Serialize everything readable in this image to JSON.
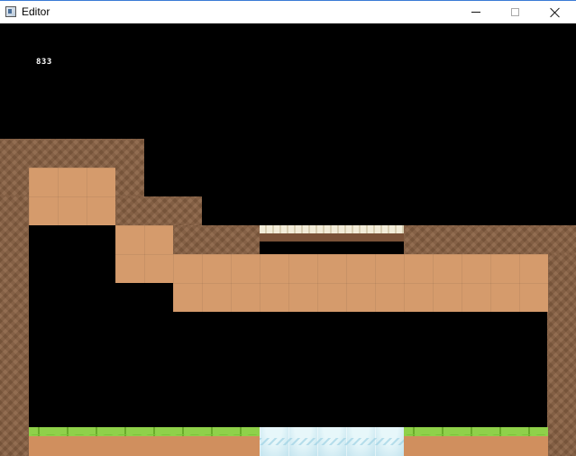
{
  "window": {
    "title": "Editor",
    "controls": [
      "minimize",
      "maximize",
      "close"
    ]
  },
  "hud": {
    "counter": "833"
  },
  "icons": {
    "app": "app-window-icon",
    "minimize": "minimize-icon",
    "maximize": "maximize-icon",
    "close": "close-icon"
  },
  "colors": {
    "background": "#000000",
    "dirt_dark": "#8a6244",
    "dirt_light": "#d59b6c",
    "grass": "#7cc23a",
    "ice": "#d3eef5",
    "bridge": "#eee6cf"
  }
}
